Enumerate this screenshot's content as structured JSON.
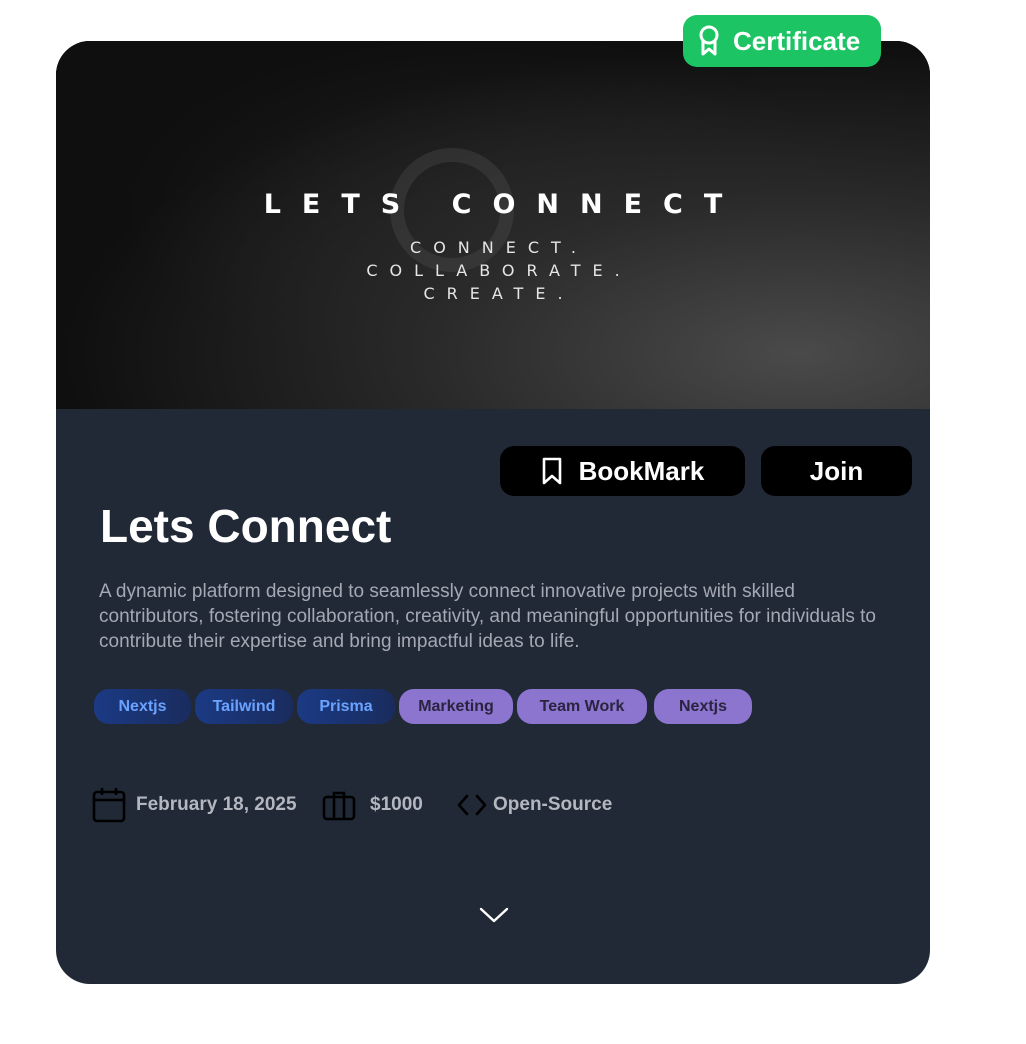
{
  "certificate_badge": {
    "label": "Certificate",
    "icon": "award-ribbon-icon",
    "color": "#1cc463"
  },
  "banner": {
    "title": "LETS CONNECT",
    "tagline_lines": [
      "CONNECT.",
      "COLLABORATE.",
      "CREATE."
    ]
  },
  "actions": {
    "bookmark_label": "BookMark",
    "bookmark_icon": "bookmark-icon",
    "join_label": "Join"
  },
  "project": {
    "title": "Lets Connect",
    "description": "A dynamic platform designed to seamlessly connect innovative projects with skilled contributors, fostering collaboration, creativity, and meaningful opportunities for individuals to contribute their expertise and bring impactful ideas to life."
  },
  "tags": [
    {
      "label": "Nextjs",
      "kind": "tech"
    },
    {
      "label": "Tailwind",
      "kind": "tech"
    },
    {
      "label": "Prisma",
      "kind": "tech"
    },
    {
      "label": "Marketing",
      "kind": "topic"
    },
    {
      "label": "Team Work",
      "kind": "topic"
    },
    {
      "label": "Nextjs",
      "kind": "topic"
    }
  ],
  "meta": {
    "date": {
      "value": "February 18, 2025",
      "icon": "calendar-icon"
    },
    "prize": {
      "value": "$1000",
      "icon": "briefcase-icon"
    },
    "type": {
      "value": "Open-Source",
      "icon": "code-brackets-icon"
    }
  },
  "expand": {
    "icon": "chevron-down-icon"
  },
  "colors": {
    "card_background": "#212836",
    "tech_chip_text": "#6aa3ff",
    "topic_chip_background": "#8b75cf",
    "button_background": "#000000"
  }
}
